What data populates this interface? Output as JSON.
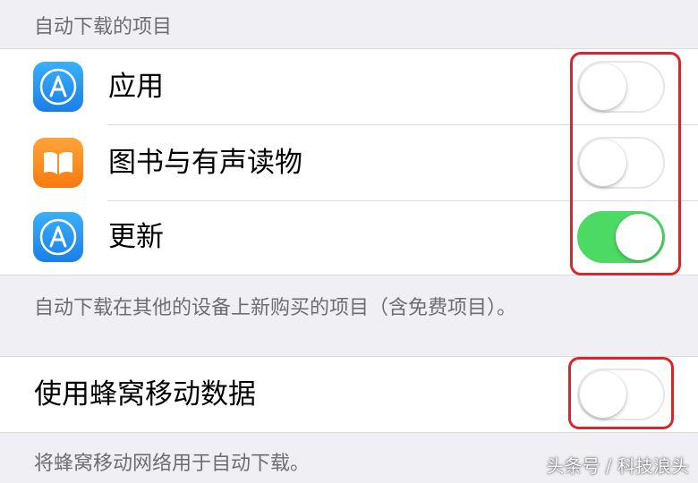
{
  "auto_downloads": {
    "header": "自动下载的项目",
    "items": [
      {
        "label": "应用",
        "icon": "app-store-icon",
        "state": "off"
      },
      {
        "label": "图书与有声读物",
        "icon": "books-icon",
        "state": "off"
      },
      {
        "label": "更新",
        "icon": "app-store-icon",
        "state": "on"
      }
    ],
    "footer": "自动下载在其他的设备上新购买的项目（含免费项目）。"
  },
  "cellular": {
    "label": "使用蜂窝移动数据",
    "state": "off",
    "footer": "将蜂窝移动网络用于自动下载。"
  },
  "watermark": "头条号 / 科技浪头",
  "colors": {
    "toggle_on": "#4cd964",
    "highlight": "#d9262c",
    "app_store_blue": "#1e8ef0",
    "books_orange": "#fc8c1c"
  }
}
